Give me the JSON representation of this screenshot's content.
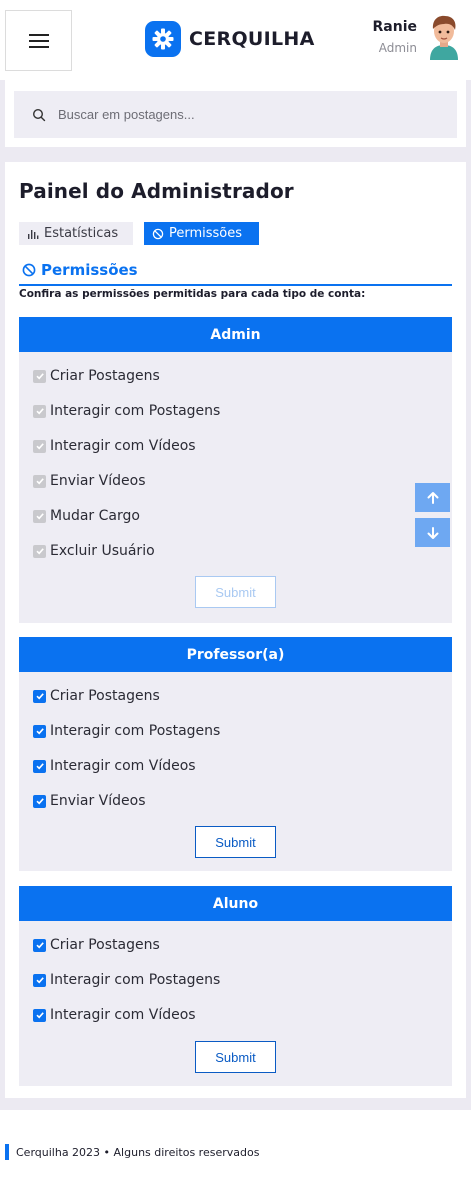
{
  "header": {
    "brand": "CERQUILHA",
    "user_name": "Ranie",
    "user_role": "Admin"
  },
  "search": {
    "placeholder": "Buscar em postagens..."
  },
  "panel": {
    "title": "Painel do Administrador",
    "tabs": [
      {
        "label": "Estatísticas",
        "active": false
      },
      {
        "label": "Permissões",
        "active": true
      }
    ],
    "section_title": "Permissões",
    "section_desc": "Confira as permissões permitidas para cada tipo de conta:"
  },
  "groups": [
    {
      "name": "Admin",
      "disabled": true,
      "permissions": [
        {
          "label": "Criar Postagens",
          "checked": true
        },
        {
          "label": "Interagir com Postagens",
          "checked": true
        },
        {
          "label": "Interagir com Vídeos",
          "checked": true
        },
        {
          "label": "Enviar Vídeos",
          "checked": true
        },
        {
          "label": "Mudar Cargo",
          "checked": true
        },
        {
          "label": "Excluir Usuário",
          "checked": true
        }
      ],
      "submit_label": "Submit"
    },
    {
      "name": "Professor(a)",
      "disabled": false,
      "permissions": [
        {
          "label": "Criar Postagens",
          "checked": true
        },
        {
          "label": "Interagir com Postagens",
          "checked": true
        },
        {
          "label": "Interagir com Vídeos",
          "checked": true
        },
        {
          "label": "Enviar Vídeos",
          "checked": true
        }
      ],
      "submit_label": "Submit"
    },
    {
      "name": "Aluno",
      "disabled": false,
      "permissions": [
        {
          "label": "Criar Postagens",
          "checked": true
        },
        {
          "label": "Interagir com Postagens",
          "checked": true
        },
        {
          "label": "Interagir com Vídeos",
          "checked": true
        }
      ],
      "submit_label": "Submit"
    }
  ],
  "footer": {
    "text": "Cerquilha 2023 • Alguns direitos reservados"
  },
  "colors": {
    "accent": "#0a72f0",
    "band": "#eceaf2",
    "group_bg": "#eeedf4"
  }
}
